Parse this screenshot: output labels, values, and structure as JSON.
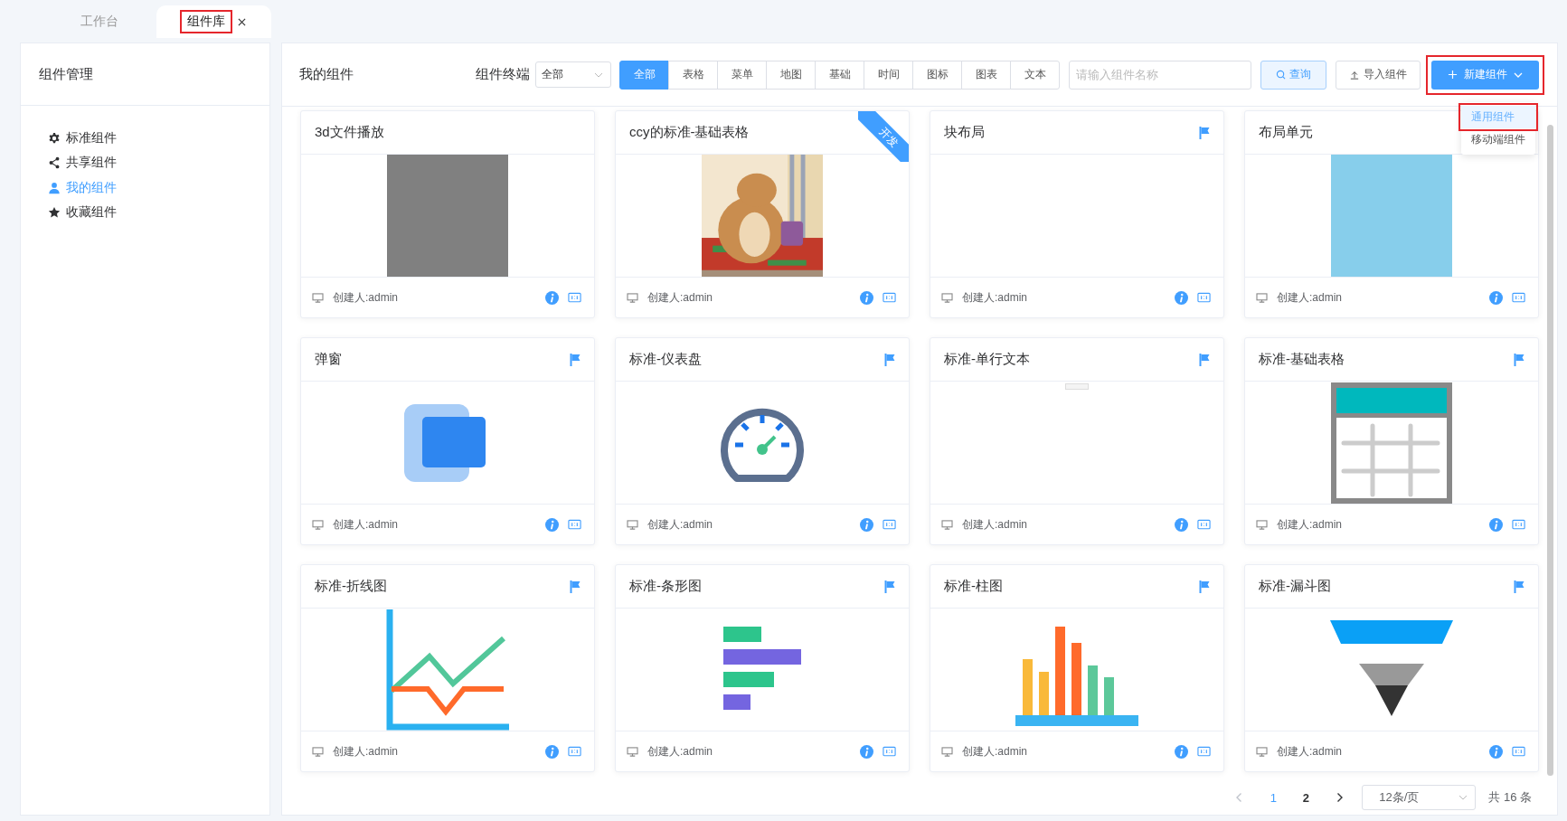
{
  "tabs": [
    {
      "label": "工作台",
      "selected": false,
      "closable": false,
      "highlighted": false
    },
    {
      "label": "组件库",
      "selected": true,
      "closable": true,
      "highlighted": true
    }
  ],
  "sidebar": {
    "title": "组件管理",
    "items": [
      {
        "label": "标准组件",
        "kind": "gear",
        "selected": false
      },
      {
        "label": "共享组件",
        "kind": "share",
        "selected": false
      },
      {
        "label": "我的组件",
        "kind": "user",
        "selected": true
      },
      {
        "label": "收藏组件",
        "kind": "star",
        "selected": false
      }
    ]
  },
  "main": {
    "title": "我的组件",
    "terminal_label": "组件终端",
    "terminal_value": "全部",
    "filters": [
      {
        "label": "全部",
        "selected": true
      },
      {
        "label": "表格",
        "selected": false
      },
      {
        "label": "菜单",
        "selected": false
      },
      {
        "label": "地图",
        "selected": false
      },
      {
        "label": "基础",
        "selected": false
      },
      {
        "label": "时间",
        "selected": false
      },
      {
        "label": "图标",
        "selected": false
      },
      {
        "label": "图表",
        "selected": false
      },
      {
        "label": "文本",
        "selected": false
      }
    ],
    "search": {
      "placeholder": "请输入组件名称"
    },
    "query_button": "查询",
    "import_button": "导入组件",
    "new_button": {
      "label": "新建组件",
      "highlighted": true
    },
    "new_menu": [
      {
        "label": "通用组件",
        "selected": true,
        "highlighted": true
      },
      {
        "label": "移动端组件",
        "selected": false,
        "highlighted": false
      }
    ],
    "cards": [
      {
        "title": "3d文件播放",
        "kind": "gray",
        "flag": false,
        "creator": "创建人:admin"
      },
      {
        "title": "ccy的标准-基础表格",
        "kind": "picture",
        "flag": false,
        "ribbon": "开发",
        "creator": "创建人:admin"
      },
      {
        "title": "块布局",
        "kind": "blank",
        "flag": true,
        "creator": "创建人:admin"
      },
      {
        "title": "布局单元",
        "kind": "lightblue",
        "flag": false,
        "creator": "创建人:admin"
      },
      {
        "title": "弹窗",
        "kind": "dialog",
        "flag": true,
        "creator": "创建人:admin"
      },
      {
        "title": "标准-仪表盘",
        "kind": "gauge",
        "flag": true,
        "creator": "创建人:admin"
      },
      {
        "title": "标准-单行文本",
        "kind": "text",
        "flag": true,
        "creator": "创建人:admin"
      },
      {
        "title": "标准-基础表格",
        "kind": "table",
        "flag": true,
        "creator": "创建人:admin"
      },
      {
        "title": "标准-折线图",
        "kind": "line",
        "flag": true,
        "creator": "创建人:admin"
      },
      {
        "title": "标准-条形图",
        "kind": "hbar",
        "flag": true,
        "creator": "创建人:admin"
      },
      {
        "title": "标准-柱图",
        "kind": "column",
        "flag": true,
        "creator": "创建人:admin"
      },
      {
        "title": "标准-漏斗图",
        "kind": "funnel",
        "flag": true,
        "creator": "创建人:admin"
      }
    ],
    "pagination": {
      "pages": [
        {
          "label": "1",
          "selected": true
        },
        {
          "label": "2",
          "selected": false
        }
      ],
      "prev_disabled": true,
      "page_size": "12条/页",
      "total": "共 16 条"
    }
  }
}
